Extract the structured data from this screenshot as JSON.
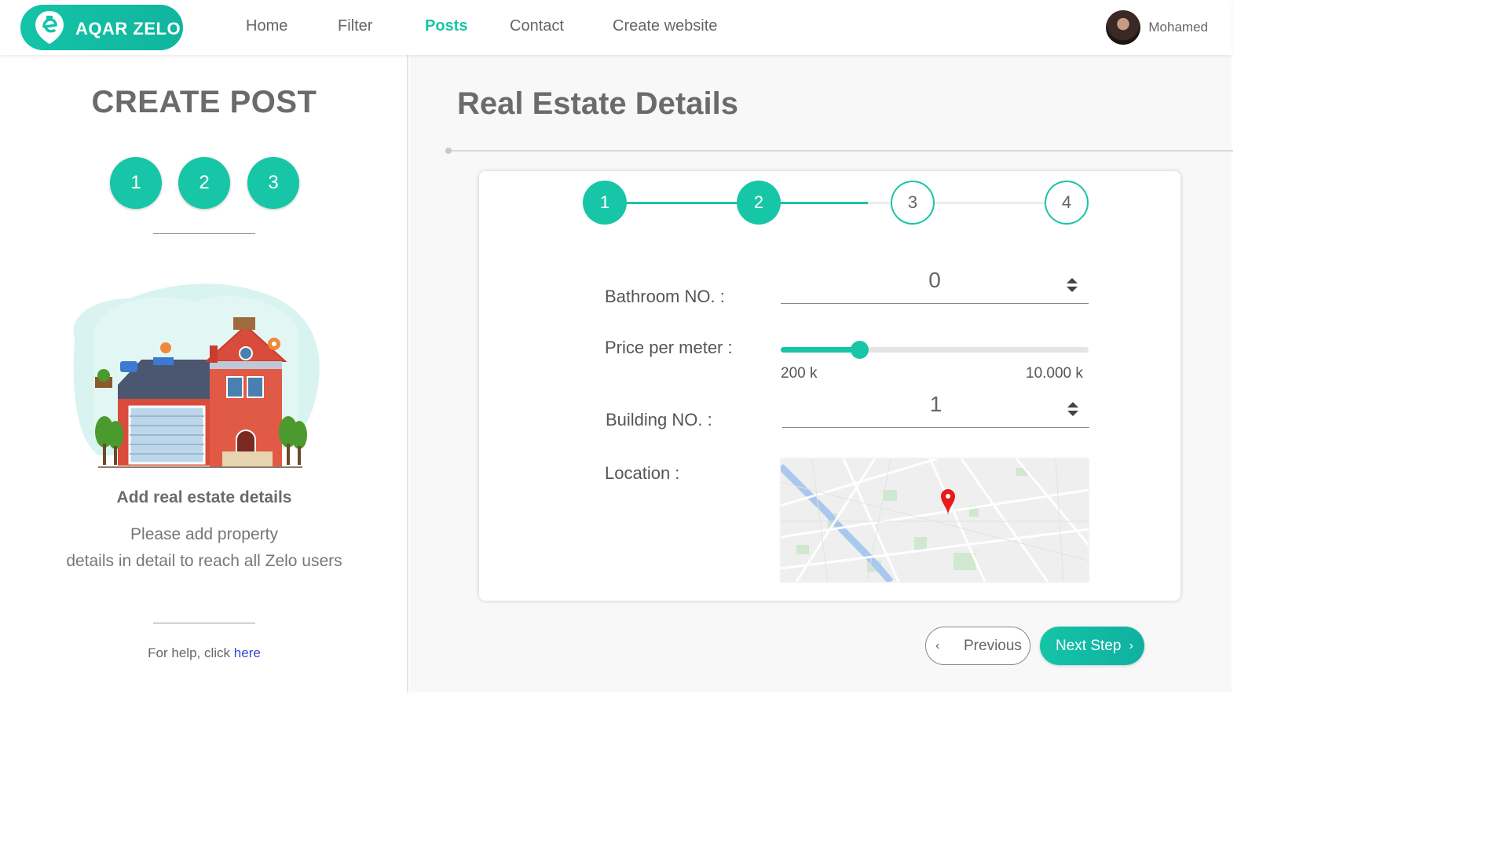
{
  "brand": {
    "name": "AQAR ZELO",
    "accent": "#17c6a6"
  },
  "nav": {
    "items": [
      {
        "label": "Home"
      },
      {
        "label": "Filter"
      },
      {
        "label": "Posts",
        "active": true
      },
      {
        "label": "Contact"
      },
      {
        "label": "Create website"
      }
    ]
  },
  "user": {
    "name": "Mohamed"
  },
  "left": {
    "title": "CREATE POST",
    "steps": [
      "1",
      "2",
      "3"
    ],
    "subtitle": "Add real estate details",
    "description_line1": "Please add property",
    "description_line2": "details in detail to reach all Zelo users",
    "help_text": "For help, click",
    "help_link": "here"
  },
  "main": {
    "title": "Real Estate Details",
    "wizard": {
      "steps": [
        {
          "label": "1",
          "state": "done"
        },
        {
          "label": "2",
          "state": "done"
        },
        {
          "label": "3",
          "state": "todo"
        },
        {
          "label": "4",
          "state": "todo"
        }
      ]
    },
    "form": {
      "bathroom_label": "Bathroom NO. :",
      "bathroom_value": "0",
      "price_label": "Price per meter :",
      "price_min_label": "200 k",
      "price_max_label": "10.000 k",
      "price_level": 0.255,
      "building_label": "Building NO. :",
      "building_value": "1",
      "location_label": "Location :"
    },
    "buttons": {
      "previous": "Previous",
      "next": "Next Step"
    }
  }
}
